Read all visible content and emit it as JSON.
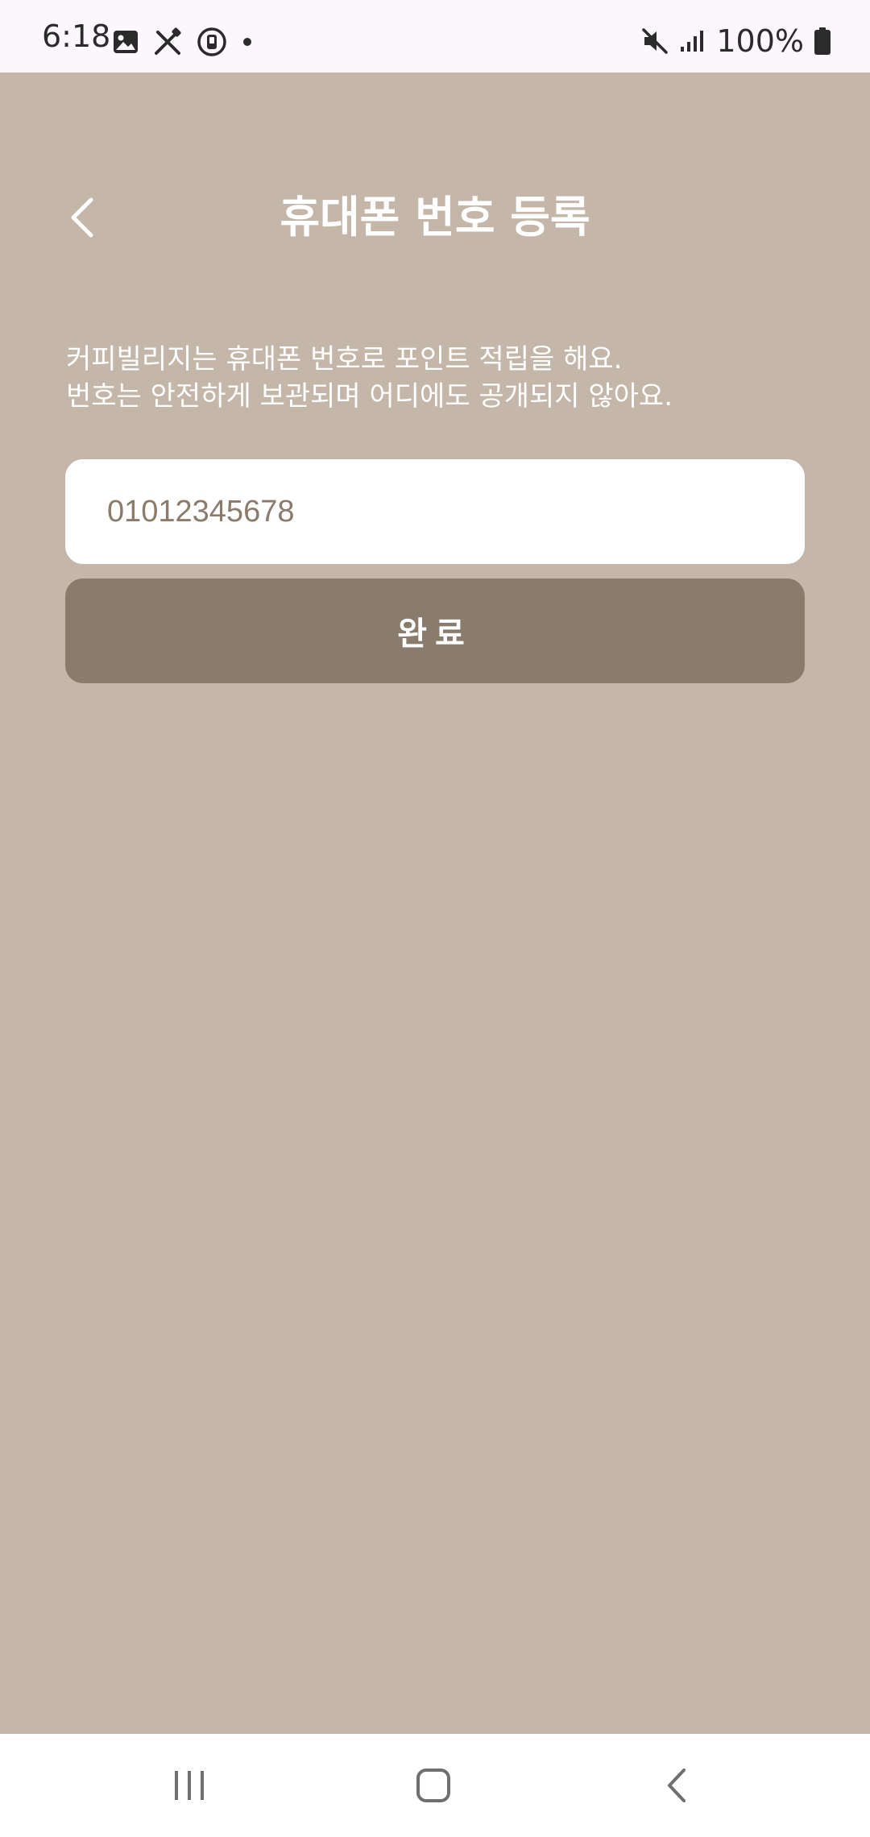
{
  "status_bar": {
    "time": "6:18",
    "battery": "100%",
    "left_icons": [
      "gallery-icon",
      "tools-icon",
      "timer-app-icon",
      "dot-icon"
    ],
    "right_icons": [
      "mute-icon",
      "signal-icon",
      "battery-icon"
    ]
  },
  "header": {
    "title": "휴대폰 번호 등록",
    "back_icon": "chevron-left-icon"
  },
  "description": {
    "line1": "커피빌리지는 휴대폰 번호로 포인트 적립을 해요.",
    "line2": "번호는 안전하게 보관되며 어디에도 공개되지 않아요."
  },
  "phone_field": {
    "value": "01012345678",
    "placeholder": ""
  },
  "submit": {
    "label": "완료"
  },
  "nav_bar": {
    "items": [
      "recents-icon",
      "home-icon",
      "back-icon"
    ]
  },
  "colors": {
    "background": "#c4b6a8",
    "button": "#8a7c6c",
    "input_text": "#8a7b6b",
    "status_bar": "#fbf7fc"
  }
}
